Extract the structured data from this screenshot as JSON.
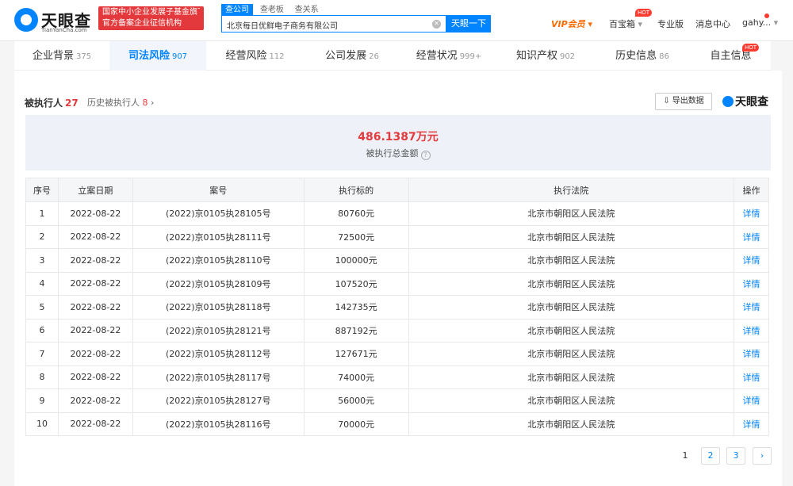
{
  "header": {
    "logo_name": "天眼查",
    "logo_domain": "TianYanCha.com",
    "badge_line1": "国家中小企业发展子基金旗下",
    "badge_line2": "官方备案企业征信机构",
    "search_tabs": [
      "查公司",
      "查老板",
      "查关系"
    ],
    "search_value": "北京每日优鲜电子商务有限公司",
    "search_button": "天眼一下",
    "vip": "VIP会员",
    "treasure": "百宝箱",
    "hot": "HOT",
    "pro": "专业版",
    "messages": "消息中心",
    "user": "gahy..."
  },
  "tabs": [
    {
      "label": "企业背景",
      "count": "375"
    },
    {
      "label": "司法风险",
      "count": "907"
    },
    {
      "label": "经营风险",
      "count": "112"
    },
    {
      "label": "公司发展",
      "count": "26"
    },
    {
      "label": "经营状况",
      "count": "999+"
    },
    {
      "label": "知识产权",
      "count": "902"
    },
    {
      "label": "历史信息",
      "count": "86"
    },
    {
      "label": "自主信息",
      "count": ""
    }
  ],
  "section": {
    "title": "被执行人",
    "count": "27",
    "history_label": "历史被执行人",
    "history_count": "8",
    "export": "导出数据",
    "brand": "天眼查"
  },
  "summary": {
    "amount": "486.1387万元",
    "label": "被执行总金额"
  },
  "table": {
    "headers": [
      "序号",
      "立案日期",
      "案号",
      "执行标的",
      "执行法院",
      "操作"
    ],
    "rows": [
      [
        "1",
        "2022-08-22",
        "(2022)京0105执28105号",
        "80760元",
        "北京市朝阳区人民法院",
        "详情"
      ],
      [
        "2",
        "2022-08-22",
        "(2022)京0105执28111号",
        "72500元",
        "北京市朝阳区人民法院",
        "详情"
      ],
      [
        "3",
        "2022-08-22",
        "(2022)京0105执28110号",
        "100000元",
        "北京市朝阳区人民法院",
        "详情"
      ],
      [
        "4",
        "2022-08-22",
        "(2022)京0105执28109号",
        "107520元",
        "北京市朝阳区人民法院",
        "详情"
      ],
      [
        "5",
        "2022-08-22",
        "(2022)京0105执28118号",
        "142735元",
        "北京市朝阳区人民法院",
        "详情"
      ],
      [
        "6",
        "2022-08-22",
        "(2022)京0105执28121号",
        "887192元",
        "北京市朝阳区人民法院",
        "详情"
      ],
      [
        "7",
        "2022-08-22",
        "(2022)京0105执28112号",
        "127671元",
        "北京市朝阳区人民法院",
        "详情"
      ],
      [
        "8",
        "2022-08-22",
        "(2022)京0105执28117号",
        "74000元",
        "北京市朝阳区人民法院",
        "详情"
      ],
      [
        "9",
        "2022-08-22",
        "(2022)京0105执28127号",
        "56000元",
        "北京市朝阳区人民法院",
        "详情"
      ],
      [
        "10",
        "2022-08-22",
        "(2022)京0105执28116号",
        "70000元",
        "北京市朝阳区人民法院",
        "详情"
      ]
    ]
  },
  "pagination": {
    "pages": [
      "1",
      "2",
      "3"
    ],
    "current": "1",
    "next": "›"
  }
}
